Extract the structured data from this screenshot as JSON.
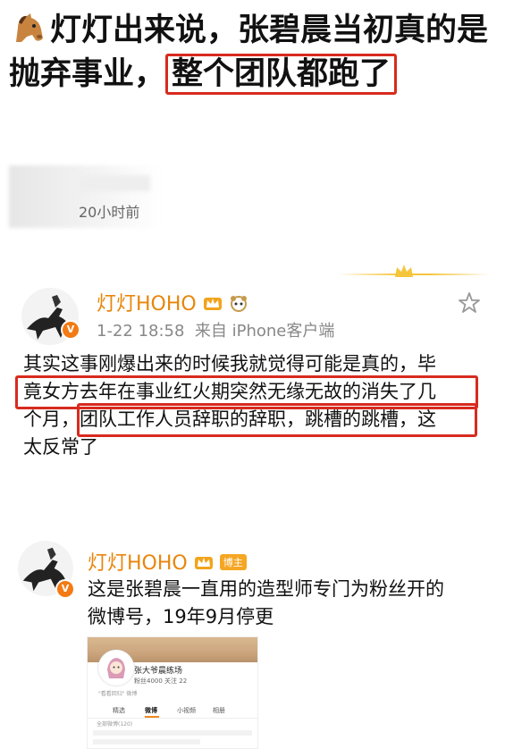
{
  "headline": {
    "part1": "灯灯出来说，张碧晨当初真的是抛弃事业，",
    "highlight": "整个团队都跑了"
  },
  "top_card": {
    "time_ago": "20小时前"
  },
  "post1": {
    "username": "灯灯HOHO",
    "date": "1-22 18:58",
    "source": "来自 iPhone客户端",
    "text_a": "其实这事刚爆出来的时候我就觉得可能是真的，毕",
    "text_b": "竟女方去年在事业红火期突然无缘无故的消失了几",
    "text_c1": "个月，",
    "text_c2": "团队工作人员辞职的辞职，跳槽的跳槽，这",
    "text_d": "太反常了",
    "verified_mark": "V"
  },
  "post2": {
    "username": "灯灯HOHO",
    "tag": "博主",
    "text_a": "这是张碧晨一直用的造型师专门为粉丝开的",
    "text_b": "微博号，19年9月停更",
    "verified_mark": "V"
  },
  "embedded": {
    "name": "张大爷晨练场",
    "stats": "粉丝4000  关注 22",
    "small": "\"看看回归\" 微博",
    "tabs": [
      "精选",
      "微博",
      "小视频",
      "相册"
    ],
    "active_tab": "微博",
    "list_label": "全部微博(120)"
  },
  "colors": {
    "accent_red": "#d82a1f",
    "username_orange": "#e8860c",
    "crown_gold": "#f5c53c"
  }
}
